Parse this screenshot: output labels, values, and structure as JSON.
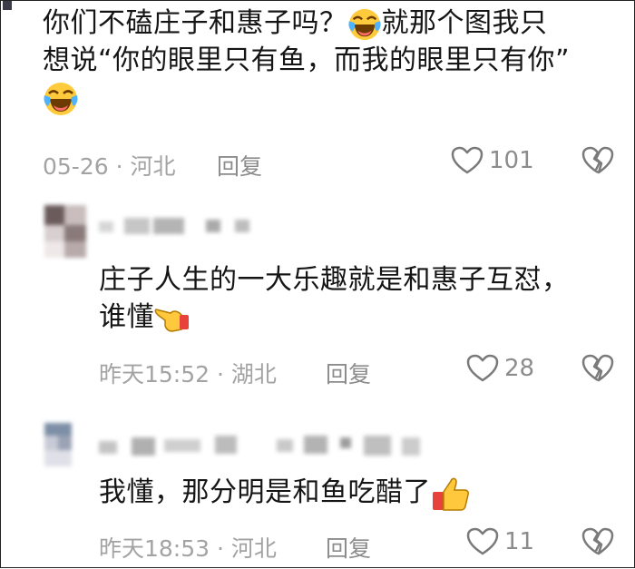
{
  "comments": [
    {
      "text_line1": "你们不磕庄子和惠子吗？",
      "text_line1b": "就那个图我只",
      "text_line2": "想说“你的眼里只有鱼，而我的眼里只有你”",
      "date": "05-26",
      "separator": "·",
      "location": "河北",
      "reply_label": "回复",
      "likes": "101"
    },
    {
      "text_line1": "庄子人生的一大乐趣就是和惠子互怼，",
      "text_line2": "谁懂",
      "date": "昨天15:52",
      "separator": "·",
      "location": "湖北",
      "reply_label": "回复",
      "likes": "28"
    },
    {
      "text_line1": "我懂，那分明是和鱼吃醋了",
      "date": "昨天18:53",
      "separator": "·",
      "location": "河北",
      "reply_label": "回复",
      "likes": "11"
    }
  ],
  "icons": {
    "laugh_cry": "laughing-crying-emoji-icon",
    "point": "pointing-hand-emoji-icon",
    "thumb": "thumbs-up-emoji-icon",
    "like": "heart-icon",
    "dislike": "broken-heart-icon"
  },
  "colors": {
    "text": "#151515",
    "meta": "#a3a3a3",
    "reply": "#8c8c8c"
  }
}
